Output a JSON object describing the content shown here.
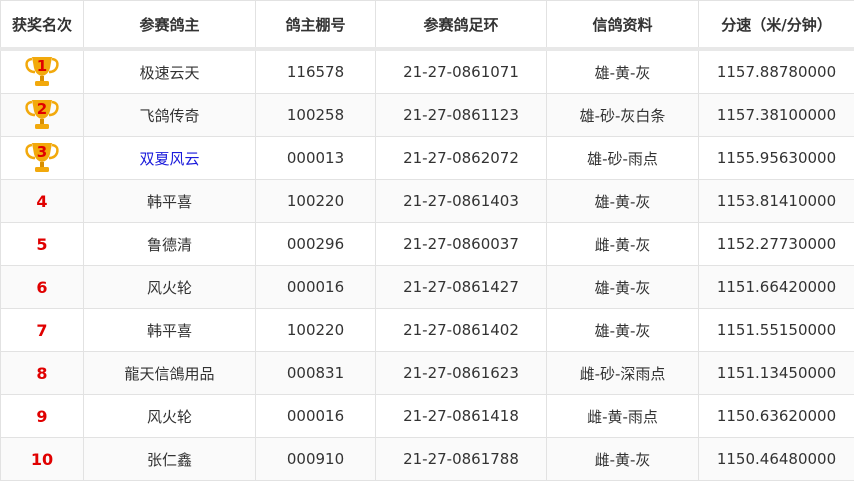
{
  "columns": [
    "获奖名次",
    "参赛鸽主",
    "鸽主棚号",
    "参赛鸽足环",
    "信鸽资料",
    "分速（米/分钟）"
  ],
  "rows": [
    {
      "rank": "1",
      "trophy": true,
      "owner": "极速云天",
      "owner_link": false,
      "loft": "116578",
      "ring": "21-27-0861071",
      "info": "雄-黄-灰",
      "speed": "1157.88780000"
    },
    {
      "rank": "2",
      "trophy": true,
      "owner": "飞鸽传奇",
      "owner_link": false,
      "loft": "100258",
      "ring": "21-27-0861123",
      "info": "雄-砂-灰白条",
      "speed": "1157.38100000"
    },
    {
      "rank": "3",
      "trophy": true,
      "owner": "双夏风云",
      "owner_link": true,
      "loft": "000013",
      "ring": "21-27-0862072",
      "info": "雄-砂-雨点",
      "speed": "1155.95630000"
    },
    {
      "rank": "4",
      "trophy": false,
      "owner": "韩平喜",
      "owner_link": false,
      "loft": "100220",
      "ring": "21-27-0861403",
      "info": "雄-黄-灰",
      "speed": "1153.81410000"
    },
    {
      "rank": "5",
      "trophy": false,
      "owner": "鲁德清",
      "owner_link": false,
      "loft": "000296",
      "ring": "21-27-0860037",
      "info": "雌-黄-灰",
      "speed": "1152.27730000"
    },
    {
      "rank": "6",
      "trophy": false,
      "owner": "风火轮",
      "owner_link": false,
      "loft": "000016",
      "ring": "21-27-0861427",
      "info": "雄-黄-灰",
      "speed": "1151.66420000"
    },
    {
      "rank": "7",
      "trophy": false,
      "owner": "韩平喜",
      "owner_link": false,
      "loft": "100220",
      "ring": "21-27-0861402",
      "info": "雄-黄-灰",
      "speed": "1151.55150000"
    },
    {
      "rank": "8",
      "trophy": false,
      "owner": "龍天信鴿用品",
      "owner_link": false,
      "loft": "000831",
      "ring": "21-27-0861623",
      "info": "雌-砂-深雨点",
      "speed": "1151.13450000"
    },
    {
      "rank": "9",
      "trophy": false,
      "owner": "风火轮",
      "owner_link": false,
      "loft": "000016",
      "ring": "21-27-0861418",
      "info": "雌-黄-雨点",
      "speed": "1150.63620000"
    },
    {
      "rank": "10",
      "trophy": false,
      "owner": "张仁鑫",
      "owner_link": false,
      "loft": "000910",
      "ring": "21-27-0861788",
      "info": "雌-黄-灰",
      "speed": "1150.46480000"
    }
  ],
  "colors": {
    "rank": "#e00000",
    "trophy": "#f2a90c",
    "link": "#1a1adb"
  }
}
